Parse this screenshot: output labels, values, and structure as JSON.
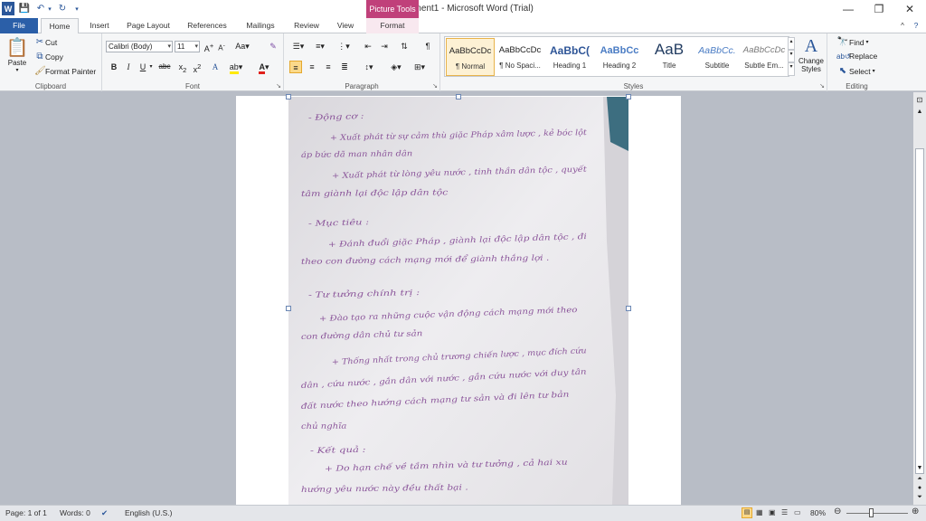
{
  "title_bar": {
    "title": "Document1 - Microsoft Word (Trial)",
    "contextual_tab": "Picture Tools"
  },
  "tabs": [
    "File",
    "Home",
    "Insert",
    "Page Layout",
    "References",
    "Mailings",
    "Review",
    "View",
    "Format"
  ],
  "clipboard": {
    "paste": "Paste",
    "cut": "Cut",
    "copy": "Copy",
    "format_painter": "Format Painter",
    "label": "Clipboard"
  },
  "font": {
    "name": "Calibri (Body)",
    "size": "11",
    "label": "Font"
  },
  "paragraph": {
    "label": "Paragraph"
  },
  "styles": {
    "label": "Styles",
    "items": [
      {
        "sample": "AaBbCcDc",
        "name": "¶ Normal"
      },
      {
        "sample": "AaBbCcDc",
        "name": "¶ No Spaci..."
      },
      {
        "sample": "AaBbC(",
        "name": "Heading 1"
      },
      {
        "sample": "AaBbCc",
        "name": "Heading 2"
      },
      {
        "sample": "AaB",
        "name": "Title"
      },
      {
        "sample": "AaBbCc.",
        "name": "Subtitle"
      },
      {
        "sample": "AaBbCcDc",
        "name": "Subtle Em..."
      }
    ],
    "change_styles": "Change Styles"
  },
  "editing": {
    "find": "Find",
    "replace": "Replace",
    "select": "Select",
    "label": "Editing"
  },
  "handwriting_lines": [
    "- Động cơ :",
    "+ Xuất phát từ sự cảm thù giặc Pháp xâm lược , kẻ bóc lột",
    "áp bức dã man nhân dân",
    "+ Xuất phát từ lòng yêu nước , tinh thần dân tộc , quyết",
    "tâm giành lại độc lập dân tộc",
    "- Mục tiêu :",
    "+ Đánh đuổi giặc Pháp , giành lại độc lập dân tộc , đi",
    "theo con đường cách mạng mới để giành thắng lợi .",
    "- Tư tưởng chính trị :",
    "+ Đào tạo ra những cuộc vận động cách mạng mới theo",
    "con đường dân chủ tư sản",
    "+ Thống nhất trong chủ trương chiến lược , mục đích cứu",
    "dân , cứu nước , gắn dân với nước , gắn cứu nước với duy tân",
    "đất nước theo hướng cách mạng tư sản và đi lên tư bản",
    "chủ nghĩa",
    "- Kết quả :",
    "+ Do hạn chế về tầm nhìn và tư tưởng , cả hai xu",
    "hướng yêu nước này đều thất bại ."
  ],
  "status": {
    "page": "Page: 1 of 1",
    "words": "Words: 0",
    "language": "English (U.S.)",
    "zoom": "80%"
  },
  "colors": {
    "file_tab": "#2b5fa8",
    "contextual": "#c0407a",
    "ink": "#7a3b8c"
  }
}
